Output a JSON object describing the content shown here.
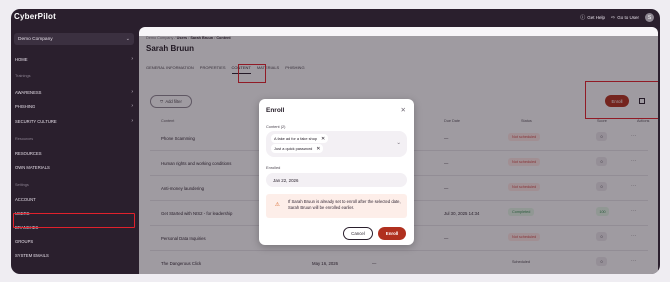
{
  "app": {
    "logo": "CyberPilot"
  },
  "topbar": {
    "help_label": "Get Help",
    "go_to_user_label": "Go to User",
    "avatar_initial": "S"
  },
  "sidebar": {
    "company": "Demo Company",
    "items": [
      {
        "label": "HOME"
      },
      {
        "label": "AWARENESS"
      },
      {
        "label": "PHISHING"
      },
      {
        "label": "SECURITY CULTURE"
      },
      {
        "label": "RESOURCES"
      },
      {
        "label": "OWN MATERIALS"
      },
      {
        "label": "ACCOUNT"
      },
      {
        "label": "USERS"
      },
      {
        "label": "BRANCHES"
      },
      {
        "label": "GROUPS"
      },
      {
        "label": "SYSTEM EMAILS"
      }
    ],
    "groups": [
      "Trainings",
      "Resources",
      "Settings"
    ]
  },
  "breadcrumb": [
    "Demo Company",
    "Users",
    "Sarah Bruun",
    "Content"
  ],
  "page": {
    "title": "Sarah Bruun"
  },
  "tabs": [
    "GENERAL INFORMATION",
    "PROPERTIES",
    "CONTENT",
    "MATERIALS",
    "PHISHING"
  ],
  "toolbar": {
    "add_filter": "Add filter",
    "enroll": "Enroll"
  },
  "table": {
    "columns": [
      "Content",
      "Due Date",
      "Status",
      "Score",
      "Actions"
    ],
    "rows": [
      {
        "content": "Phone Scamming",
        "enrolled": "",
        "due": "—",
        "status": "Not scheduled",
        "score": "0"
      },
      {
        "content": "Human rights and working conditions",
        "enrolled": "",
        "due": "—",
        "status": "Not scheduled",
        "score": "0"
      },
      {
        "content": "Anti-money laundering",
        "enrolled": "",
        "due": "—",
        "status": "Not scheduled",
        "score": "0"
      },
      {
        "content": "Get Started with NIS2 - for leadership",
        "enrolled": "",
        "due": "Jul 30, 2025 14:34",
        "status": "Completed",
        "score": "100"
      },
      {
        "content": "Personal Data Inquiries",
        "enrolled": "",
        "due": "—",
        "status": "Not scheduled",
        "score": "0"
      },
      {
        "content": "The Dangerous Click",
        "enrolled": "May 16, 2026",
        "due": "—",
        "status": "Scheduled",
        "score": "0"
      }
    ],
    "row_actions": "···"
  },
  "modal": {
    "title": "Enroll",
    "content_label": "Content (2)",
    "chips": [
      "A fake ad for a fake shop",
      "Just a quick password"
    ],
    "enrolled_label": "Enrolled",
    "enrolled_value": "Jan 22, 2026",
    "warning": "If Sarah Bruun is already set to enroll after the selected date, Sarah Bruun will be enrolled earlier.",
    "cancel": "Cancel",
    "enroll": "Enroll"
  },
  "colors": {
    "brand_dark": "#2a1f2d",
    "accent": "#b0301f",
    "highlight_box": "#e0212c"
  }
}
